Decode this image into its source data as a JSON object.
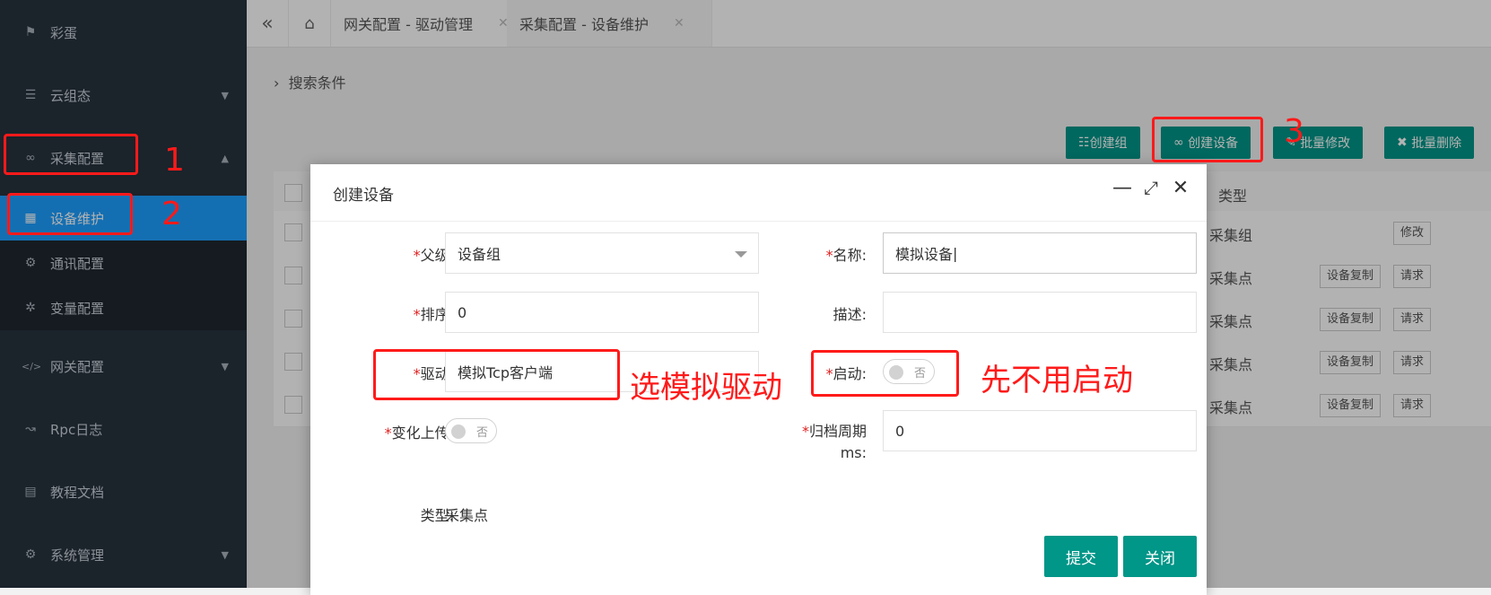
{
  "sidebar": {
    "items": [
      {
        "label": "彩蛋",
        "icon": "thumbs-up-icon",
        "glyph": "👍"
      },
      {
        "label": "云组态",
        "icon": "signpost-icon",
        "glyph": "⛿"
      },
      {
        "label": "采集配置",
        "icon": "infinity-icon",
        "glyph": "∞"
      },
      {
        "label": "设备维护",
        "icon": "device-icon",
        "glyph": "▦"
      },
      {
        "label": "通讯配置",
        "icon": "cog-icon",
        "glyph": "⚙"
      },
      {
        "label": "变量配置",
        "icon": "cog-icon",
        "glyph": "✲"
      },
      {
        "label": "网关配置",
        "icon": "code-icon",
        "glyph": "</>"
      },
      {
        "label": "Rpc日志",
        "icon": "rpc-icon",
        "glyph": "↝"
      },
      {
        "label": "教程文档",
        "icon": "document-icon",
        "glyph": "▤"
      },
      {
        "label": "系统管理",
        "icon": "settings-icon",
        "glyph": "⚙"
      }
    ]
  },
  "header": {
    "tabs": [
      {
        "label": "网关配置 - 驱动管理"
      },
      {
        "label": "采集配置 - 设备维护"
      }
    ]
  },
  "main": {
    "search_label": "搜索条件",
    "toolbar": {
      "create_group": "创建组",
      "create_device": "创建设备",
      "batch_edit": "批量修改",
      "batch_delete": "批量删除"
    },
    "table": {
      "type_header": "类型",
      "rows": [
        {
          "type": "采集组",
          "btn1": "",
          "btn2": "修改"
        },
        {
          "type": "采集点",
          "btn1": "设备复制",
          "btn2": "请求"
        },
        {
          "type": "采集点",
          "btn1": "设备复制",
          "btn2": "请求"
        },
        {
          "type": "采集点",
          "btn1": "设备复制",
          "btn2": "请求"
        },
        {
          "type": "采集点",
          "btn1": "设备复制",
          "btn2": "请求"
        }
      ]
    }
  },
  "modal": {
    "title": "创建设备",
    "fields": {
      "parent_label": "父级:",
      "parent_value": "设备组",
      "name_label": "名称:",
      "name_value": "模拟设备",
      "order_label": "排序:",
      "order_value": "0",
      "desc_label": "描述:",
      "desc_value": "",
      "driver_label": "驱动:",
      "driver_value": "模拟Tcp客户端",
      "enable_label": "启动:",
      "enable_value": "否",
      "change_upload_label": "变化上传:",
      "change_upload_value": "否",
      "archive_label_line1": "归档周期",
      "archive_label_line2": "ms:",
      "archive_value": "0",
      "type_label": "类型:",
      "type_value": "采集点"
    },
    "submit_label": "提交",
    "close_label": "关闭"
  },
  "annotations": {
    "step1": "1",
    "step2": "2",
    "step3": "3",
    "driver_note": "选模拟驱动",
    "enable_note": "先不用启动",
    "color": "#ff1a1a"
  }
}
